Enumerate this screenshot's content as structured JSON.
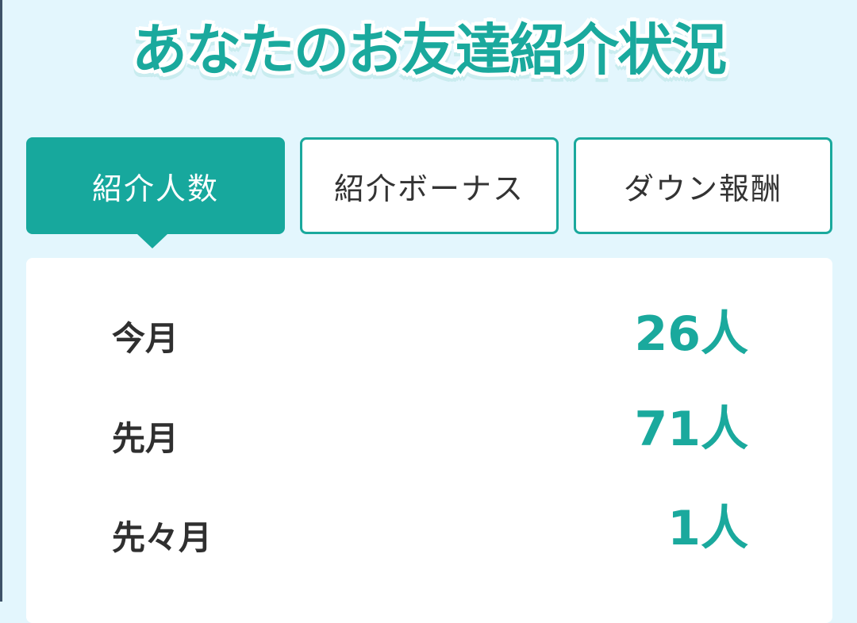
{
  "title": "あなたのお友達紹介状況",
  "tabs": [
    {
      "label": "紹介人数",
      "active": true
    },
    {
      "label": "紹介ボーナス",
      "active": false
    },
    {
      "label": "ダウン報酬",
      "active": false
    }
  ],
  "stats": [
    {
      "label": "今月",
      "value": "26人"
    },
    {
      "label": "先月",
      "value": "71人"
    },
    {
      "label": "先々月",
      "value": "1人"
    }
  ],
  "colors": {
    "accent": "#1aa99d",
    "background": "#e3f6fd",
    "panel": "#ffffff",
    "text": "#2f2f2f"
  }
}
